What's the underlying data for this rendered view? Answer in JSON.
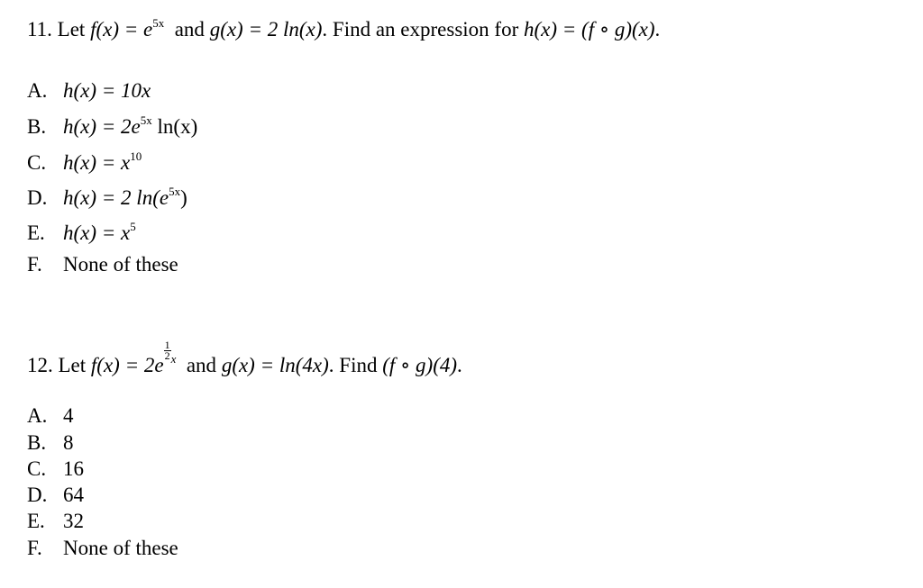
{
  "questions": [
    {
      "number": "11.",
      "prompt": {
        "let": "Let",
        "f": "f(x) = e",
        "f_exp": "5x",
        "and": "and",
        "g": "g(x) = 2 ln(x)",
        "find": ". Find an expression for",
        "h": "h(x) = (f ∘ g)(x)",
        "end": "."
      },
      "options": [
        {
          "letter": "A.",
          "text": "h(x) = 10x"
        },
        {
          "letter": "B.",
          "text": "h(x) = 2e",
          "sup": "5x",
          "after": " ln(x)"
        },
        {
          "letter": "C.",
          "text": "h(x) = x",
          "sup": "10",
          "after": ""
        },
        {
          "letter": "D.",
          "text": "h(x) = 2 ln(e",
          "sup": "5x",
          "after": ")"
        },
        {
          "letter": "E.",
          "text": "h(x) = x",
          "sup": "5",
          "after": ""
        },
        {
          "letter": "F.",
          "text": "None of these"
        }
      ]
    },
    {
      "number": "12.",
      "prompt": {
        "let": "Let",
        "f": "f(x) = 2e",
        "f_exp_num": "1",
        "f_exp_den": "2",
        "f_exp_var": "x",
        "and": "and",
        "g": "g(x) = ln(4x)",
        "find": ". Find",
        "expr": "(f ∘ g)(4)",
        "end": "."
      },
      "options": [
        {
          "letter": "A.",
          "text": "4"
        },
        {
          "letter": "B.",
          "text": "8"
        },
        {
          "letter": "C.",
          "text": "16"
        },
        {
          "letter": "D.",
          "text": "64"
        },
        {
          "letter": "E.",
          "text": "32"
        },
        {
          "letter": "F.",
          "text": "None of these"
        }
      ]
    }
  ]
}
